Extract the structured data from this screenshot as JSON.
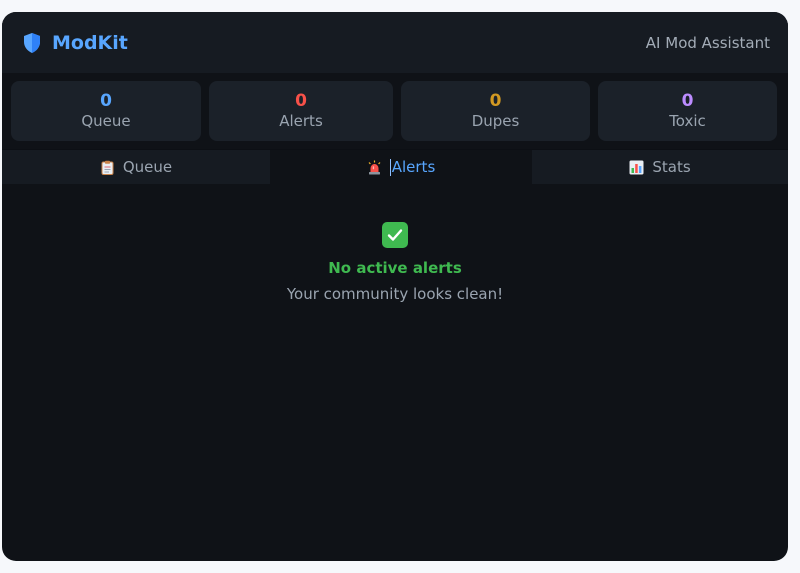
{
  "header": {
    "brand": "ModKit",
    "subtitle": "AI Mod Assistant",
    "logo_icon": "shield-icon"
  },
  "stats": [
    {
      "value": "0",
      "label": "Queue",
      "color": "#58a6ff"
    },
    {
      "value": "0",
      "label": "Alerts",
      "color": "#f85149"
    },
    {
      "value": "0",
      "label": "Dupes",
      "color": "#d29922"
    },
    {
      "value": "0",
      "label": "Toxic",
      "color": "#bc8cff"
    }
  ],
  "tabs": [
    {
      "label": "Queue",
      "icon": "clipboard-icon",
      "active": false
    },
    {
      "label": "Alerts",
      "icon": "siren-icon",
      "active": true
    },
    {
      "label": "Stats",
      "icon": "bar-chart-icon",
      "active": false
    }
  ],
  "empty_state": {
    "icon": "check-icon",
    "title": "No active alerts",
    "message": "Your community looks clean!"
  },
  "colors": {
    "accent": "#58a6ff",
    "success": "#3fb950",
    "danger": "#f85149",
    "warning": "#d29922",
    "purple": "#bc8cff"
  }
}
